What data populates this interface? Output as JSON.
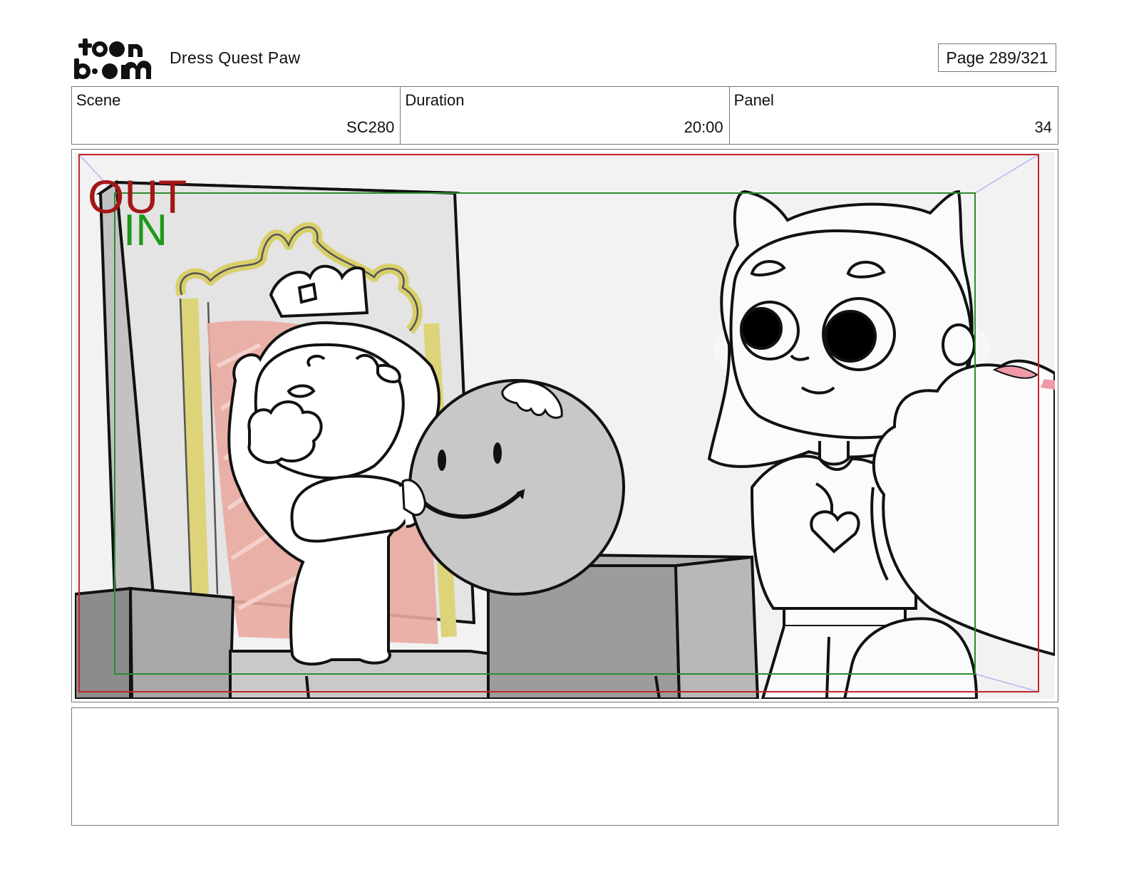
{
  "header": {
    "logo_text": "toonboom",
    "project_title": "Dress Quest Paw",
    "page_label": "Page 289/321"
  },
  "info": {
    "scene_label": "Scene",
    "scene_value": "SC280",
    "duration_label": "Duration",
    "duration_value": "20:00",
    "panel_label": "Panel",
    "panel_value": "34"
  },
  "panel": {
    "safe_frame_out_label": "OUT",
    "safe_frame_in_label": "IN",
    "colors": {
      "out_frame": "#c0262c",
      "in_frame": "#2e8b2e",
      "throne_gold": "#e0d67a",
      "throne_red": "#e8a79e",
      "ball_gray": "#c8c8c8"
    }
  },
  "notes": {
    "text": ""
  }
}
